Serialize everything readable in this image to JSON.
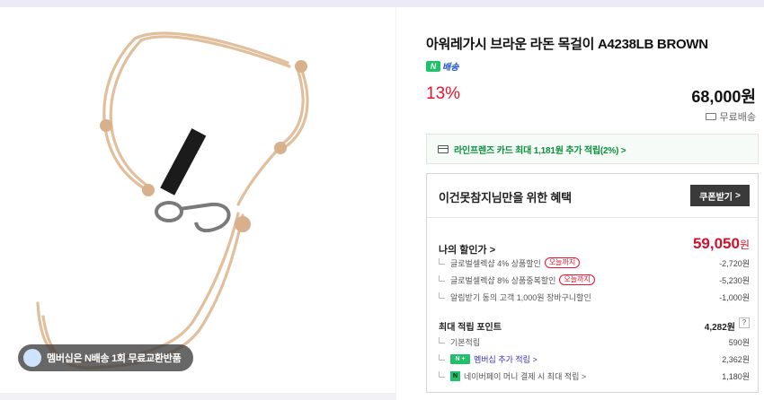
{
  "product": {
    "title": "아워레가시 브라운 라돈 목걸이 A4238LB BROWN",
    "delivery_badge": "배송",
    "delivery_icon": "N",
    "discount_rate": "13%",
    "price": "68,000원",
    "shipping": "무료배송"
  },
  "membership_banner": "멤버십은 N배송 1회 무료교환반품",
  "card_promo": "라인프렌즈 카드 최대 1,181원 추가 적립(2%) >",
  "benefit": {
    "heading": "이건못참지님만을 위한 혜택",
    "coupon_button": "쿠폰받기",
    "coupon_arrow": ">",
    "my_sale_label": "나의 할인가 >",
    "my_sale_price": "59,050",
    "my_sale_won": "원",
    "discounts": [
      {
        "label": "글로벌셀렉샵 4% 상품할인",
        "pill": "오늘까지",
        "value": "-2,720원"
      },
      {
        "label": "글로벌셀렉샵 8% 상품중복할인",
        "pill": "오늘까지",
        "value": "-5,230원"
      },
      {
        "label": "알림받기 동의 고객 1,000원 장바구니할인",
        "pill": "",
        "value": "-1,000원"
      }
    ],
    "points_label": "최대 적립 포인트",
    "points_value": "4,282원",
    "points_help": "?",
    "points": [
      {
        "label": "기본적립",
        "value": "590원"
      },
      {
        "label": "멤버십 추가 적립 >",
        "badge": "N +",
        "value": "2,362원"
      },
      {
        "label": "네이버페이 머니 결제 시 최대 적립 >",
        "badge": "N",
        "value": "1,180원"
      }
    ]
  },
  "colors": {
    "accent_red": "#e8142f",
    "naver_green": "#1fc16b",
    "link_blue": "#3b32c9"
  }
}
